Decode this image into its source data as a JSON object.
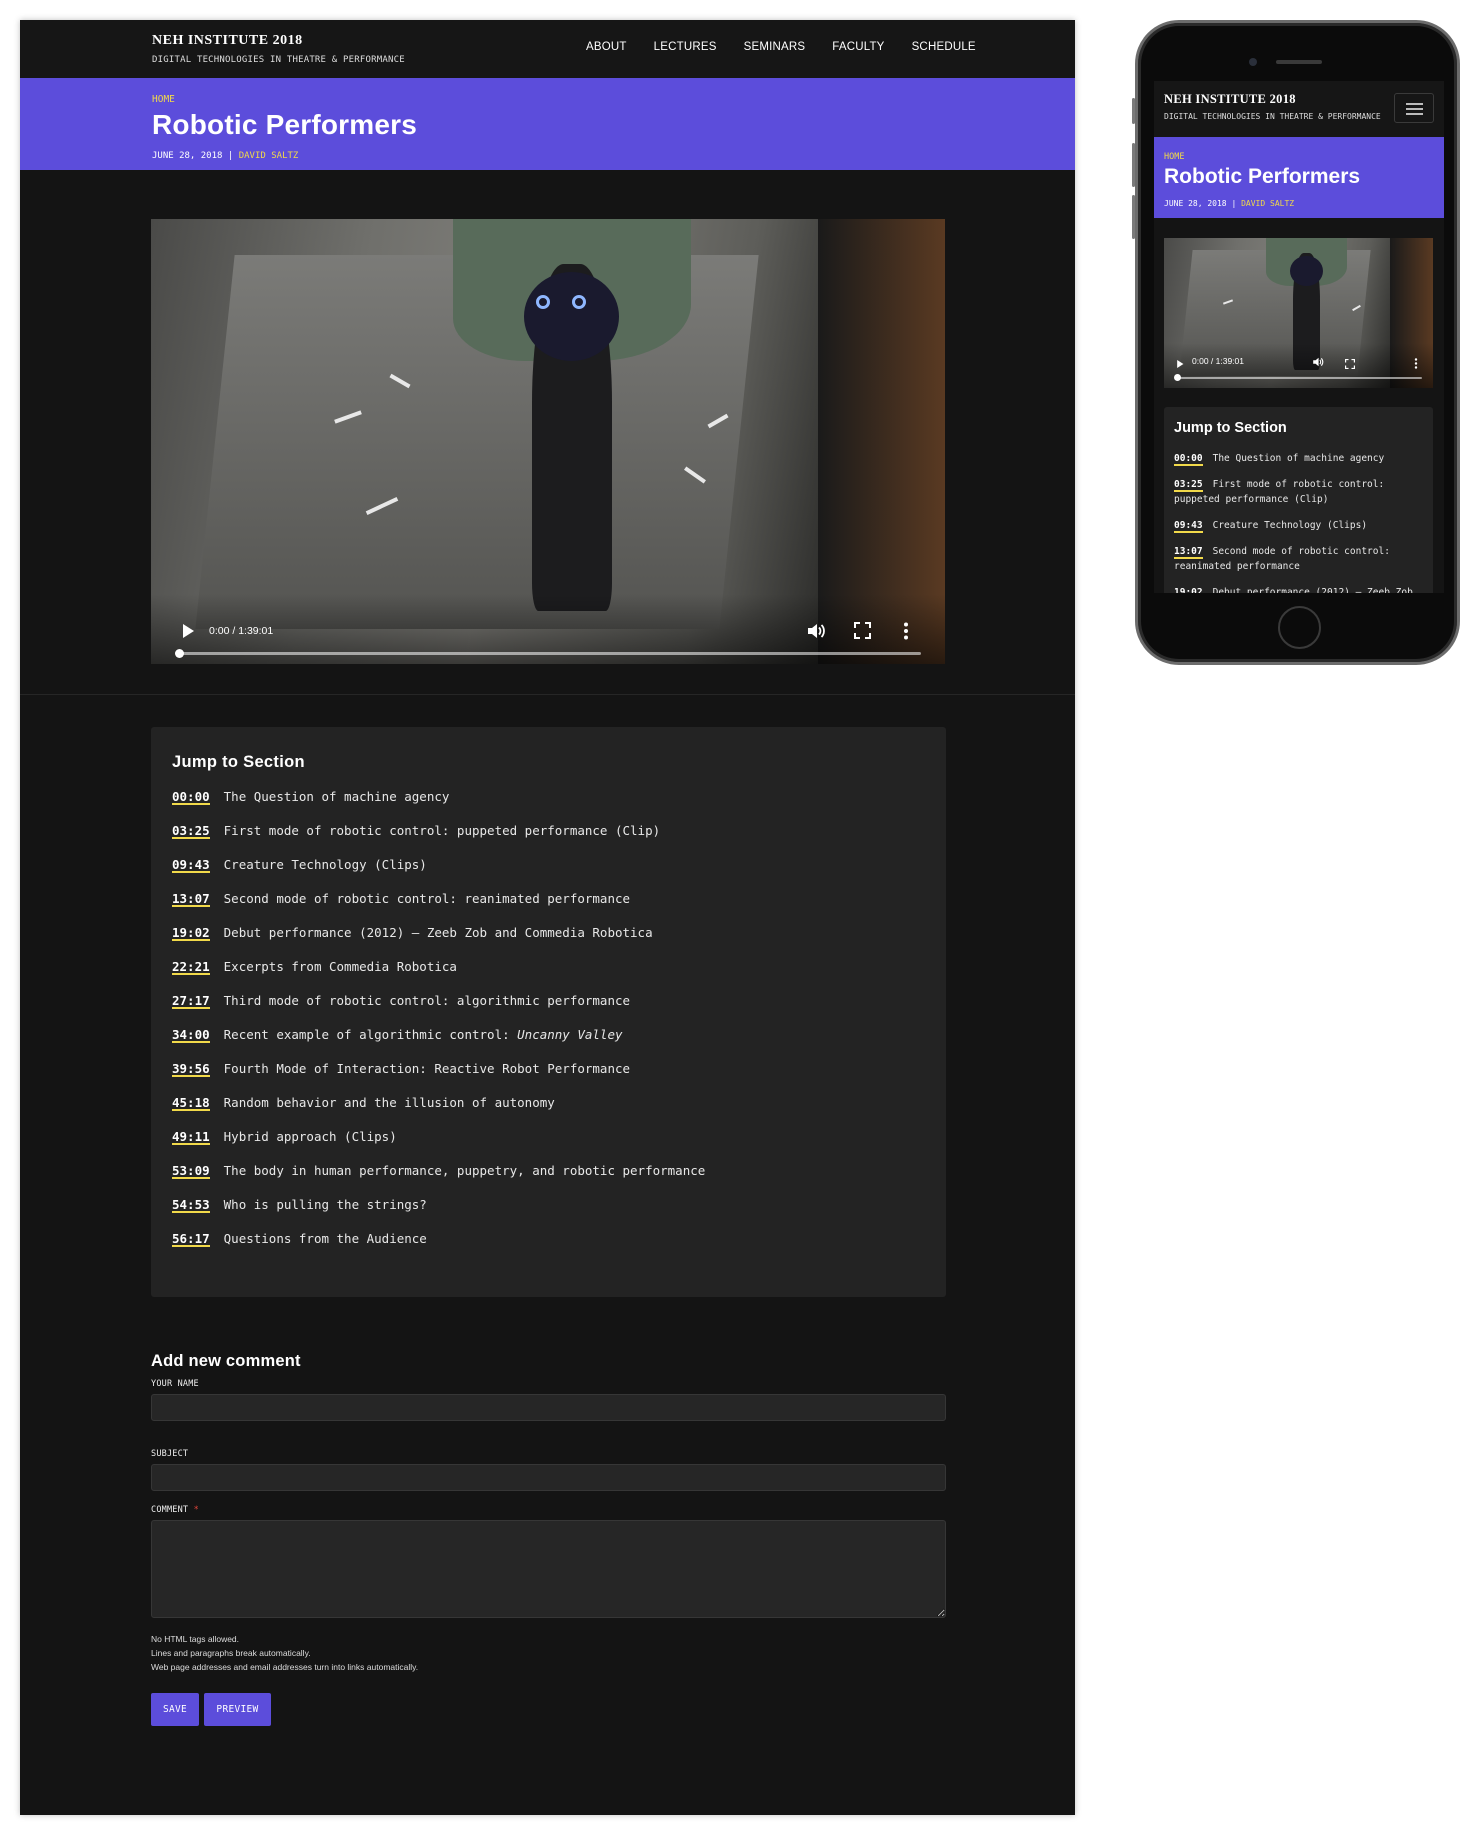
{
  "site": {
    "name": "NEH INSTITUTE 2018",
    "slogan": "DIGITAL TECHNOLOGIES IN THEATRE & PERFORMANCE"
  },
  "nav": [
    "ABOUT",
    "LECTURES",
    "SEMINARS",
    "FACULTY",
    "SCHEDULE"
  ],
  "page": {
    "breadcrumb": "HOME",
    "title": "Robotic Performers",
    "date": "JUNE 28, 2018",
    "separator": "|",
    "author": "DAVID SALTZ"
  },
  "video": {
    "time": "0:00 / 1:39:01",
    "progress": 0
  },
  "jump": {
    "heading": "Jump to Section",
    "items": [
      {
        "time": "00:00",
        "label": "The Question of machine agency"
      },
      {
        "time": "03:25",
        "label": "First mode of robotic control: puppeted performance (Clip)"
      },
      {
        "time": "09:43",
        "label": "Creature Technology (Clips)"
      },
      {
        "time": "13:07",
        "label": "Second mode of robotic control: reanimated performance"
      },
      {
        "time": "19:02",
        "label": "Debut performance (2012) – Zeeb Zob and Commedia Robotica"
      },
      {
        "time": "22:21",
        "label": "Excerpts from Commedia Robotica"
      },
      {
        "time": "27:17",
        "label": "Third mode of robotic control: algorithmic performance"
      },
      {
        "time": "34:00",
        "label": "Recent example of algorithmic control: ",
        "emph": "Uncanny Valley"
      },
      {
        "time": "39:56",
        "label": "Fourth Mode of Interaction: Reactive Robot Performance"
      },
      {
        "time": "45:18",
        "label": "Random behavior and the illusion of autonomy"
      },
      {
        "time": "49:11",
        "label": "Hybrid approach (Clips)"
      },
      {
        "time": "53:09",
        "label": "The body in human performance, puppetry, and robotic performance"
      },
      {
        "time": "54:53",
        "label": "Who is pulling the strings?"
      },
      {
        "time": "56:17",
        "label": "Questions from the Audience"
      }
    ]
  },
  "mobile_jump_items": [
    {
      "time": "00:00",
      "label": "The Question of machine agency"
    },
    {
      "time": "03:25",
      "label": "First mode of robotic control: puppeted performance (Clip)"
    },
    {
      "time": "09:43",
      "label": "Creature Technology (Clips)"
    },
    {
      "time": "13:07",
      "label": "Second mode of robotic control: reanimated performance"
    },
    {
      "time": "19:02",
      "label": "Debut performance (2012) – Zeeb Zob"
    }
  ],
  "comment_form": {
    "heading": "Add new comment",
    "name_label": "YOUR NAME",
    "subject_label": "SUBJECT",
    "comment_label": "COMMENT",
    "required_mark": "*",
    "name_value": "",
    "subject_value": "",
    "comment_value": "",
    "help": [
      "No HTML tags allowed.",
      "Lines and paragraphs break automatically.",
      "Web page addresses and email addresses turn into links automatically."
    ],
    "save_label": "SAVE",
    "preview_label": "PREVIEW"
  },
  "colors": {
    "accent": "#5c4ddb",
    "highlight": "#f1d94a",
    "background": "#141414",
    "panel": "#232323",
    "required": "#e0453a"
  },
  "icons": [
    "play-icon",
    "volume-icon",
    "fullscreen-icon",
    "more-vert-icon",
    "hamburger-menu-icon"
  ]
}
